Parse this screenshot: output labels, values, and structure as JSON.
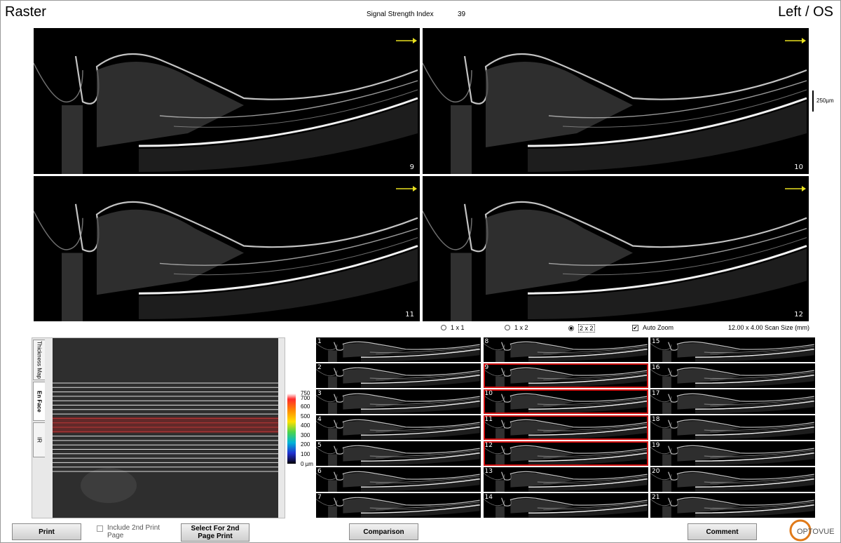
{
  "header": {
    "mode": "Raster",
    "signal_strength_label": "Signal Strength Index",
    "signal_strength_value": "39",
    "eye": "Left / OS"
  },
  "scans": [
    {
      "number": "9"
    },
    {
      "number": "10"
    },
    {
      "number": "11"
    },
    {
      "number": "12"
    }
  ],
  "scale": {
    "label": "250µm"
  },
  "layout_options": {
    "options": [
      "1 x 1",
      "1 x 2",
      "2 x 2"
    ],
    "selected": "2 x 2",
    "auto_zoom_label": "Auto Zoom",
    "auto_zoom_checked": true,
    "scan_size": "12.00 x 4.00 Scan Size (mm)"
  },
  "side_tabs": [
    "Thickness Map",
    "En Face",
    "IR"
  ],
  "active_side_tab": "En Face",
  "legend": {
    "labels": [
      "750",
      "700",
      "600",
      "500",
      "400",
      "300",
      "200",
      "100",
      "0 µm"
    ]
  },
  "thumbnails": {
    "numbers": [
      "1",
      "2",
      "3",
      "4",
      "5",
      "6",
      "7",
      "8",
      "9",
      "10",
      "11",
      "12",
      "13",
      "14",
      "15",
      "16",
      "17",
      "18",
      "19",
      "20",
      "21"
    ],
    "selected": [
      "9",
      "10",
      "11",
      "12"
    ]
  },
  "buttons": {
    "print": "Print",
    "include_2nd_line1": "Include 2nd Print",
    "include_2nd_line2": "Page",
    "select_2nd_line1": "Select For 2nd",
    "select_2nd_line2": "Page Print",
    "comparison": "Comparison",
    "comment": "Comment"
  },
  "logo": {
    "text": "OPTOVUE",
    "accent": "#e07a1a"
  },
  "colors": {
    "selection": "#d01010",
    "arrow": "#e8e020"
  }
}
